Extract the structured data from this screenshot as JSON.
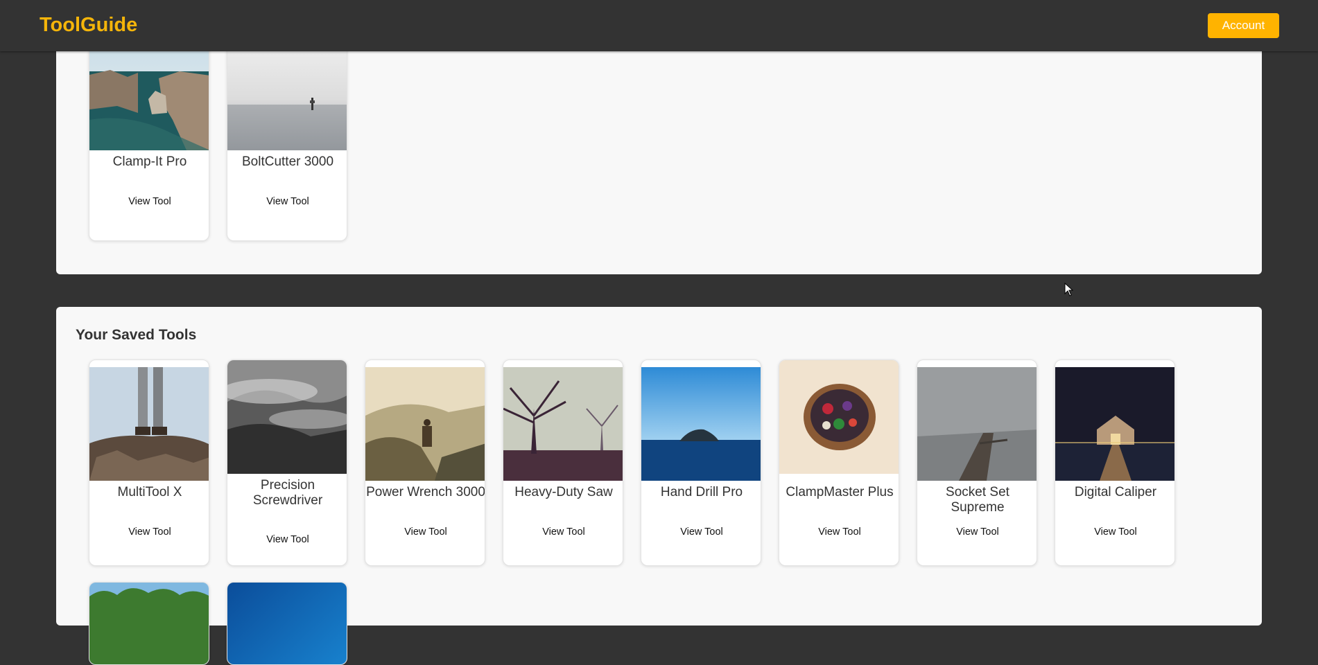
{
  "header": {
    "logo": "ToolGuide",
    "account_label": "Account"
  },
  "colors": {
    "accent": "#ffb300",
    "logo": "#f5b50a",
    "background": "#333333",
    "panel": "#f8f8f8"
  },
  "top_section": {
    "tools": [
      {
        "name": "Clamp-It Pro",
        "view_label": "View Tool",
        "image": "coastal-cliffs-photo"
      },
      {
        "name": "BoltCutter 3000",
        "view_label": "View Tool",
        "image": "misty-sea-post-photo"
      }
    ]
  },
  "saved_section": {
    "title": "Your Saved Tools",
    "tools": [
      {
        "name": "MultiTool X",
        "view_label": "View Tool",
        "image": "boots-on-rocks-photo"
      },
      {
        "name": "Precision Screwdriver",
        "view_label": "View Tool",
        "image": "foggy-forest-photo"
      },
      {
        "name": "Power Wrench 3000",
        "view_label": "View Tool",
        "image": "hiker-mountains-photo"
      },
      {
        "name": "Heavy-Duty Saw",
        "view_label": "View Tool",
        "image": "misty-trees-photo"
      },
      {
        "name": "Hand Drill Pro",
        "view_label": "View Tool",
        "image": "ocean-island-photo"
      },
      {
        "name": "ClampMaster Plus",
        "view_label": "View Tool",
        "image": "salad-bowl-photo"
      },
      {
        "name": "Socket Set Supreme",
        "view_label": "View Tool",
        "image": "foggy-pier-photo"
      },
      {
        "name": "Digital Caliper",
        "view_label": "View Tool",
        "image": "boathouse-night-photo"
      }
    ],
    "partial_tools": [
      {
        "image": "green-trees-photo"
      },
      {
        "image": "blue-water-photo"
      }
    ]
  }
}
